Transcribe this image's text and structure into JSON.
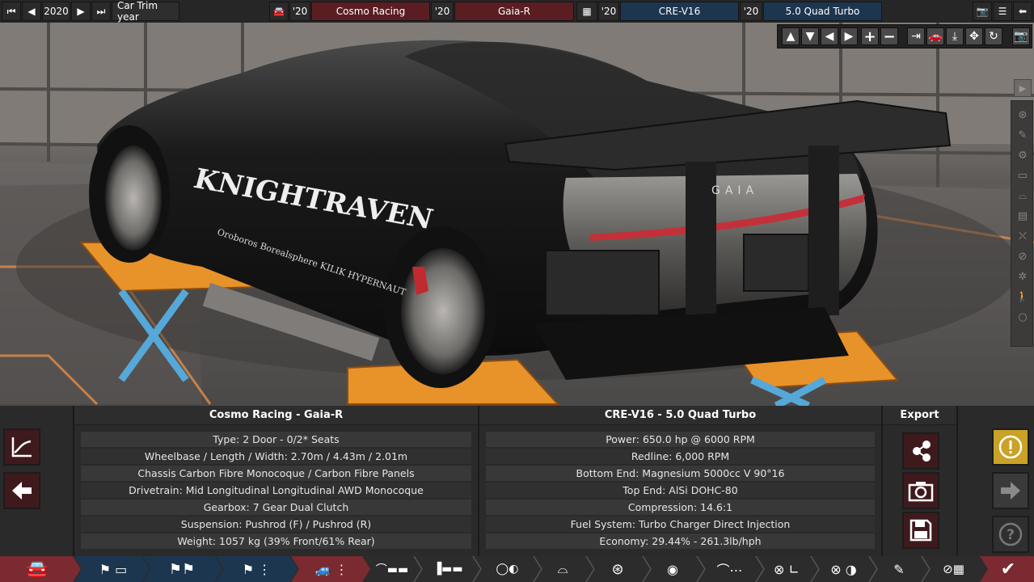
{
  "topbar": {
    "year": "2020",
    "trim_year_label": "Car Trim year",
    "body_year": "'20",
    "family_year": "'20",
    "engine_year": "'20",
    "variant_year": "'20",
    "model_family": "Cosmo Racing",
    "model_trim": "Gaia-R",
    "engine_family": "CRE-V16",
    "engine_variant": "5.0 Quad Turbo"
  },
  "scene": {
    "decal_main": "KNIGHTRAVEN",
    "decal_sponsors": "Oroboros Borealsphere KILIK HYPERNAUT",
    "rear_badge": "GAIA"
  },
  "car_panel": {
    "title": "Cosmo Racing - Gaia-R",
    "rows": [
      "Type: 2 Door - 0/2* Seats",
      "Wheelbase / Length / Width: 2.70m / 4.43m / 2.01m",
      "Chassis Carbon Fibre Monocoque / Carbon Fibre Panels",
      "Drivetrain: Mid Longitudinal Longitudinal AWD Monocoque",
      "Gearbox: 7 Gear Dual Clutch",
      "Suspension: Pushrod (F) / Pushrod (R)",
      "Weight: 1057 kg (39% Front/61% Rear)"
    ]
  },
  "engine_panel": {
    "title": "CRE-V16 - 5.0 Quad Turbo",
    "rows": [
      "Power: 650.0 hp @ 6000 RPM",
      "Redline:  6,000 RPM",
      "Bottom End: Magnesium 5000cc V 90°16",
      "Top End: AlSi DOHC-80",
      "Compression: 14.6:1",
      "Fuel System: Turbo Charger Direct Injection",
      "Economy: 29.44% - 261.3lb/hph"
    ]
  },
  "export": {
    "title": "Export"
  },
  "colors": {
    "accent_red": "#5a1e22",
    "accent_blue": "#1d3650",
    "active_tab": "#7a2a30",
    "warning": "#c9a227"
  }
}
